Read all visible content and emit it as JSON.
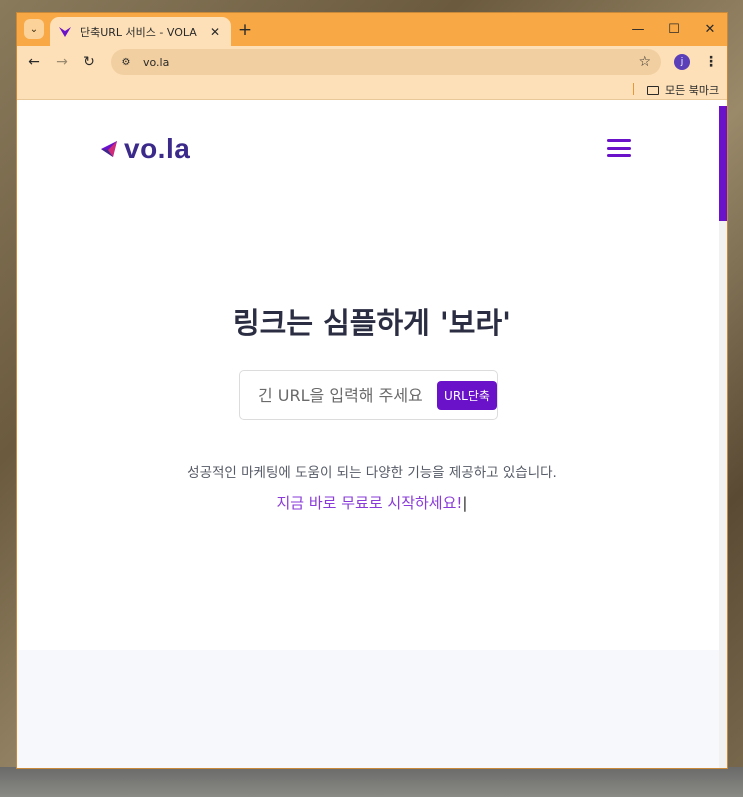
{
  "browser": {
    "tab_title": "단축URL 서비스 - VOLA",
    "tab_close": "✕",
    "new_tab": "+",
    "url": "vo.la",
    "profile_initial": "j",
    "bookmark_folder": "모든 북마크",
    "icons": {
      "tab_search": "chevron-down-icon",
      "back": "arrow-left-icon",
      "forward": "arrow-right-icon",
      "reload": "reload-icon",
      "site_info": "tune-icon",
      "bookmark_star": "star-icon",
      "menu": "kebab-menu-icon",
      "folder": "folder-icon",
      "minimize": "minimize-icon",
      "maximize": "maximize-icon",
      "close": "close-icon"
    }
  },
  "page": {
    "logo_text": "vo.la",
    "hero_title": "링크는 심플하게 '보라'",
    "input_placeholder": "긴 URL을 입력해 주세요",
    "shorten_button": "URL단축",
    "description": "성공적인 마케팅에 도움이 되는 다양한 기능을 제공하고 있습니다.",
    "cta": "지금 바로 무료로 시작하세요!"
  },
  "colors": {
    "accent": "#6a12c9",
    "title_bar": "#f8a946",
    "toolbar": "#fde0b8",
    "heading": "#2b2d42",
    "cta": "#8a3ad8"
  }
}
